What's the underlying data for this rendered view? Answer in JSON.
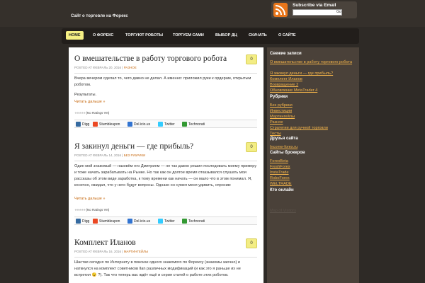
{
  "header": {
    "site_description": "Сайт о торговле на Форекс",
    "subscribe_label": "Subscribe via Email",
    "subscribe_button": "Go"
  },
  "nav": [
    {
      "label": "HOME",
      "active": true
    },
    {
      "label": "О ФОРЕКС"
    },
    {
      "label": "ТОРГУЮТ РОБОТЫ"
    },
    {
      "label": "ТОРГУЕМ САМИ"
    },
    {
      "label": "ВЫБОР ДЦ"
    },
    {
      "label": "СКАЧАТЬ"
    },
    {
      "label": "О САЙТЕ"
    }
  ],
  "posts": [
    {
      "title": "О вмешательстве в работу торгового робота",
      "comments": "0",
      "meta_prefix": "POSTED AT ФЕВРАЛЬ 20, 2016 |",
      "category": "РАЗНОЕ",
      "text": "Вчера вечером сделал то, чего давно не делал. А именно: приложил руки к ордерам, открытым роботом.",
      "text2": "Результаты.",
      "more": "Читать дальше »",
      "rating": "(No Ratings Yet)"
    },
    {
      "title": "Я закинул деньги — где прибыль?",
      "comments": "0",
      "meta_prefix": "POSTED AT ФЕВРАЛЬ 14, 2016 |",
      "category": "БЕЗ РУБРИКИ",
      "text": "Один мой знакомый — назовём его Дмитрием — не так давно решил последовать моему примеру и тоже начать зарабатывать на Рынке. Но так как он долгое время отказывался слушать мои рассказы об этом виде заработка, к тому времени как начать — он мало что в этом понимал.  Я, конечно, ожидал, что у него будут вопросы. Однако он сумел меня удивить, спросив:",
      "more": "Читать дальше »",
      "rating": "(No Ratings Yet)"
    },
    {
      "title": "Комплект Иланов",
      "comments": "0",
      "meta_prefix": "POSTED AT ФЕВРАЛЬ 16, 2016 |",
      "category": "МАРТИНГЕЙЛЫ",
      "text": "Шастая сегодня по Интернету в поисках одного знакомого по Форексу (знакомы заочно) и наткнулся на комплект советников Ilan различных модификаций (и как это я раньше их не встретил 😉 ?).  Так что теперь вас ждёт ещё и серия статей о работе этих роботов."
    }
  ],
  "share": [
    "Digg",
    "Stumbleupon",
    "Del.icio.us",
    "Twitter",
    "Technorati"
  ],
  "sidebar": {
    "recent_title": "Свежие записи",
    "recent": [
      "О вмешательстве в работу торгового робота",
      "Я закинул деньги — где прибыль?",
      "Комплект Иланов",
      "Возвращение 2",
      "Обновление MetaTrader 4"
    ],
    "rubrics_title": "Рубрики",
    "rubrics": [
      "Без рубрики",
      "Инвестиции",
      "Мартингейлы",
      "Разное",
      "Стратегии для ручной торговли",
      "Тесты"
    ],
    "friends_title": "Друзья сайта",
    "friends": [
      "Income-forex.ru"
    ],
    "brokers_title": "Сайты брокеров",
    "brokers": [
      "ForexBeta",
      "FreshForex",
      "InstaTrade",
      "RoboForex",
      "WELTRADE"
    ],
    "online_title": "Кто онлайн",
    "extra": [
      "Map of Visitors"
    ]
  }
}
